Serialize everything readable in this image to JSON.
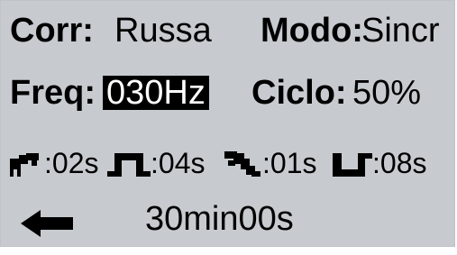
{
  "row1": {
    "current_label": "Corr:",
    "current_value": "Russa",
    "mode_label": "Modo:",
    "mode_value": "Sincr"
  },
  "row2": {
    "freq_label": "Freq:",
    "freq_value": "030Hz",
    "cycle_label": "Ciclo:",
    "cycle_value": "50%"
  },
  "row3": {
    "ramp_up": ":02s",
    "hold_on": ":04s",
    "ramp_down": ":01s",
    "hold_off": ":08s"
  },
  "row4": {
    "back_icon": "left-arrow-icon",
    "time": "30min00s"
  }
}
